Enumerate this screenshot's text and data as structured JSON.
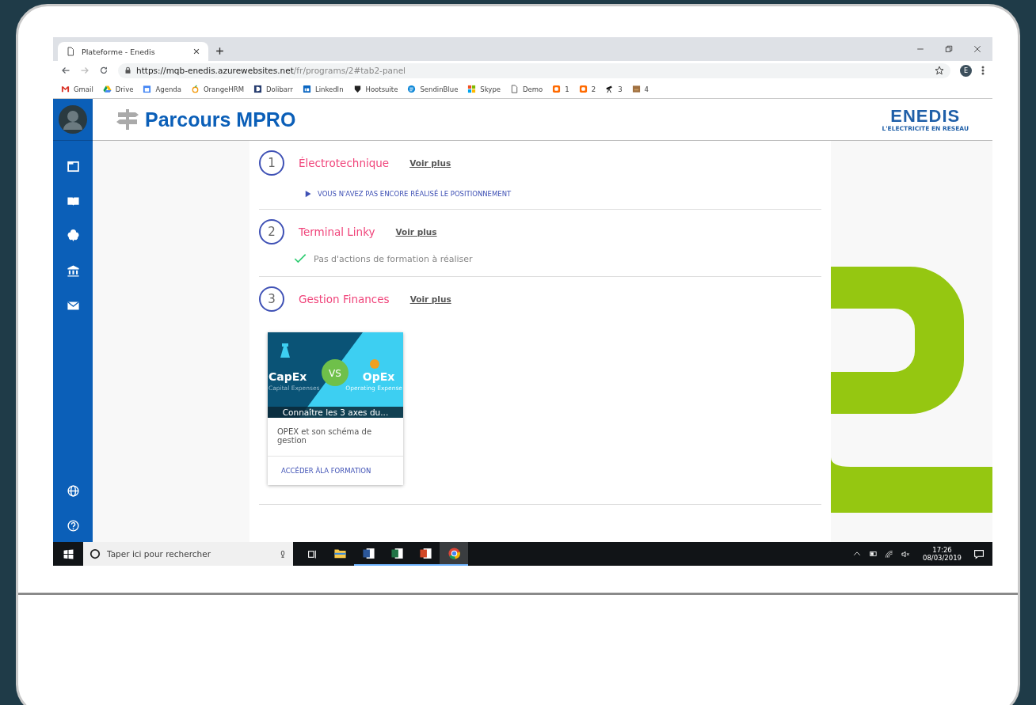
{
  "browser": {
    "tab_title": "Plateforme - Enedis",
    "url_host": "https://mqb-enedis.azurewebsites.net",
    "url_path": "/fr/programs/2#tab2-panel",
    "profile_initial": "E",
    "bookmarks": [
      {
        "kind": "gmail",
        "label": "Gmail"
      },
      {
        "kind": "drive",
        "label": "Drive"
      },
      {
        "kind": "calendar",
        "label": "Agenda"
      },
      {
        "kind": "fruit",
        "label": "OrangeHRM"
      },
      {
        "kind": "dsquare",
        "label": "Dolibarr"
      },
      {
        "kind": "insquare",
        "label": "LinkedIn"
      },
      {
        "kind": "shield",
        "label": "Hootsuite"
      },
      {
        "kind": "bluecircle",
        "label": "SendinBlue"
      },
      {
        "kind": "squares",
        "label": "Skype"
      },
      {
        "kind": "page",
        "label": "Demo"
      },
      {
        "kind": "blogger",
        "label": "1"
      },
      {
        "kind": "blogger",
        "label": "2"
      },
      {
        "kind": "telescope",
        "label": "3"
      },
      {
        "kind": "box",
        "label": "4"
      }
    ]
  },
  "app": {
    "title": "Parcours MPRO",
    "brand": {
      "name": "ENEDIS",
      "tagline": "L'ELECTRICITE EN RESEAU"
    },
    "modules": [
      {
        "number": "1",
        "title": "Électrotechnique",
        "link": "Voir plus",
        "status": {
          "kind": "pending",
          "text": "VOUS N'AVEZ PAS ENCORE RÉALISÉ LE POSITIONNEMENT"
        }
      },
      {
        "number": "2",
        "title": "Terminal Linky",
        "link": "Voir plus",
        "status": {
          "kind": "done",
          "text": "Pas d'actions de formation à réaliser"
        }
      },
      {
        "number": "3",
        "title": "Gestion Finances",
        "link": "Voir plus",
        "courses": [
          {
            "banner": {
              "left_title": "CapEx",
              "left_subtitle": "Capital Expenses",
              "middle": "VS",
              "right_title": "OpEx",
              "right_subtitle": "Operating Expense"
            },
            "caption": "Connaître les 3 axes du...",
            "title": "OPEX et son schéma de gestion",
            "action": "ACCÉDER ÀLA FORMATION"
          }
        ]
      }
    ]
  },
  "taskbar": {
    "search_placeholder": "Taper ici pour rechercher",
    "time": "17:26",
    "date": "08/03/2019",
    "apps": [
      {
        "kind": "folder",
        "running": false,
        "selected": false
      },
      {
        "kind": "word",
        "running": true,
        "selected": false
      },
      {
        "kind": "excel",
        "running": true,
        "selected": false
      },
      {
        "kind": "powerpoint",
        "running": true,
        "selected": false
      },
      {
        "kind": "chrome",
        "running": true,
        "selected": true
      }
    ]
  }
}
